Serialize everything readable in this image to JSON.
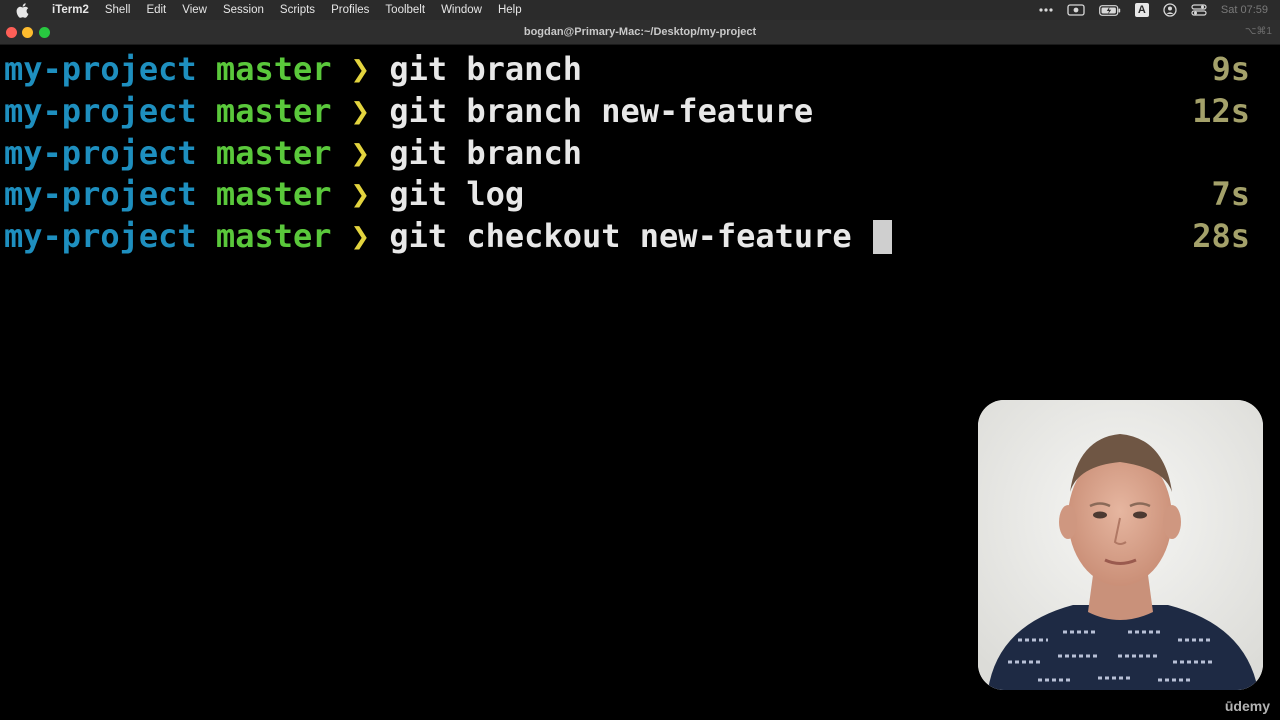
{
  "menubar": {
    "app": "iTerm2",
    "items": [
      "Shell",
      "Edit",
      "View",
      "Session",
      "Scripts",
      "Profiles",
      "Toolbelt",
      "Window",
      "Help"
    ],
    "status": {
      "input_source": "A",
      "clock": "Sat 07:59"
    }
  },
  "window": {
    "title": "bogdan@Primary-Mac:~/Desktop/my-project",
    "shortcut": "⌥⌘1"
  },
  "terminal": {
    "lines": [
      {
        "dir": "my-project",
        "branch": "master",
        "arrow": "❯",
        "command": "git branch",
        "duration": "9s"
      },
      {
        "dir": "my-project",
        "branch": "master",
        "arrow": "❯",
        "command": "git branch new-feature",
        "duration": "12s"
      },
      {
        "dir": "my-project",
        "branch": "master",
        "arrow": "❯",
        "command": "git branch",
        "duration": ""
      },
      {
        "dir": "my-project",
        "branch": "master",
        "arrow": "❯",
        "command": "git log",
        "duration": "7s"
      },
      {
        "dir": "my-project",
        "branch": "master",
        "arrow": "❯",
        "command": "git checkout new-feature ",
        "duration": "28s"
      }
    ]
  },
  "watermark": "ūdemy",
  "colors": {
    "dir": "#1e8fbf",
    "branch": "#5ac83b",
    "arrow": "#e3d43e",
    "duration": "#a4a16a"
  }
}
